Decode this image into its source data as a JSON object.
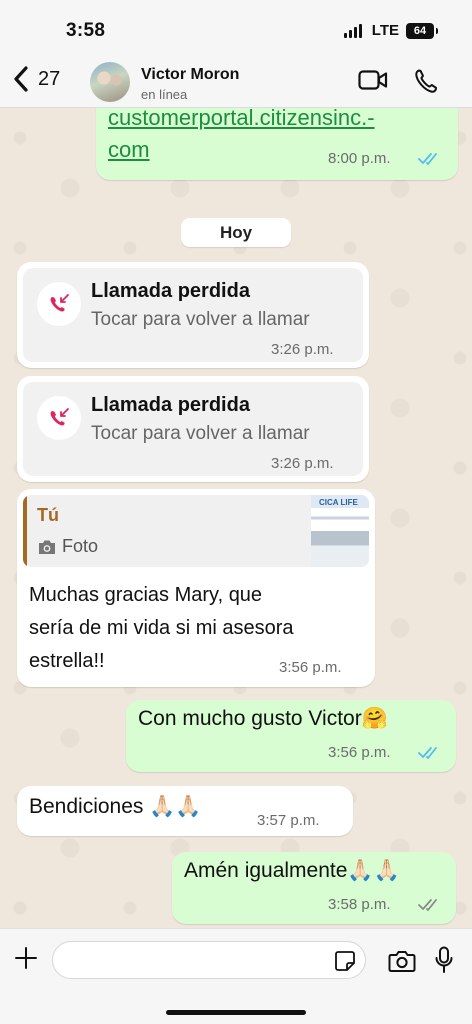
{
  "status_bar": {
    "time": "3:58",
    "network": "LTE",
    "battery": "64"
  },
  "header": {
    "back_count": "27",
    "contact_name": "Victor Moron",
    "contact_status": "en línea"
  },
  "messages": {
    "link": {
      "line1": "customerportal.citizensinc.-",
      "line2": "com",
      "time": "8:00 p.m."
    },
    "day_divider": "Hoy",
    "missed_call_1": {
      "title": "Llamada perdida",
      "subtitle": "Tocar para volver a llamar",
      "time": "3:26 p.m."
    },
    "missed_call_2": {
      "title": "Llamada perdida",
      "subtitle": "Tocar para volver a llamar",
      "time": "3:26 p.m."
    },
    "reply": {
      "quote_author": "Tú",
      "quote_type": "Foto",
      "thumb_logo": "CICA LIFE",
      "line1": "Muchas gracias Mary, que",
      "line2": "sería de mi vida si mi asesora",
      "line3": "estrella!!",
      "time": "3:56 p.m."
    },
    "out_1": {
      "text": "Con mucho gusto Victor🤗",
      "time": "3:56 p.m."
    },
    "in_1": {
      "text": "Bendiciones 🙏🏻🙏🏻",
      "time": "3:57 p.m."
    },
    "out_2": {
      "text": "Amén igualmente🙏🏻🙏🏻",
      "time": "3:58 p.m."
    }
  },
  "composer": {
    "placeholder": ""
  },
  "colors": {
    "outgoing_bubble": "#d9fdd3",
    "incoming_bubble": "#ffffff",
    "read_ticks": "#53bdeb",
    "delivered_ticks": "#8a8a8a",
    "missed_call": "#e0245e",
    "quote_accent": "#a46a24",
    "link": "#1a8f3c"
  }
}
